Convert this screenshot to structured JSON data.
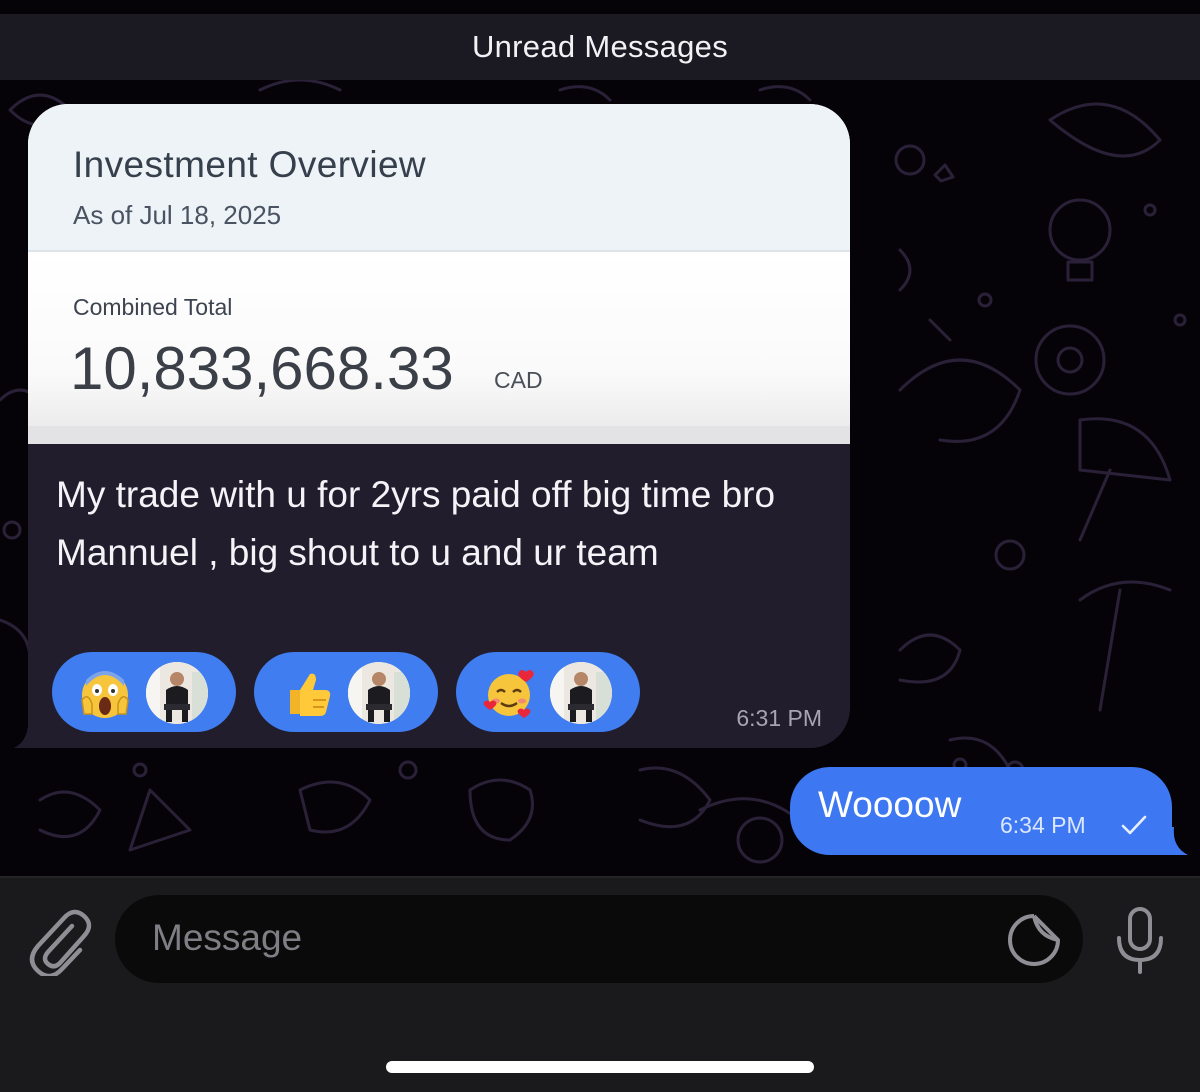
{
  "header": {
    "unread_label": "Unread Messages"
  },
  "incoming_message": {
    "screenshot": {
      "title": "Investment Overview",
      "as_of": "As of Jul 18, 2025",
      "total_label": "Combined Total",
      "total_value": "10,833,668.33",
      "currency": "CAD"
    },
    "text": "My trade with u for 2yrs paid off big time bro Mannuel , big shout to u and ur team",
    "reactions": [
      {
        "emoji": "screaming-face-emoji"
      },
      {
        "emoji": "thumbs-up-emoji"
      },
      {
        "emoji": "smiling-face-with-hearts-emoji"
      }
    ],
    "time": "6:31 PM"
  },
  "outgoing_message": {
    "text": "Woooow",
    "time": "6:34 PM",
    "status_icon": "single-check-icon"
  },
  "composer": {
    "placeholder": "Message",
    "attach_icon": "paperclip-icon",
    "sticker_icon": "sticker-icon",
    "mic_icon": "microphone-icon"
  },
  "colors": {
    "incoming_bubble": "#221d2c",
    "outgoing_bubble": "#3d78f2",
    "reaction_pill": "#3f7df0"
  }
}
